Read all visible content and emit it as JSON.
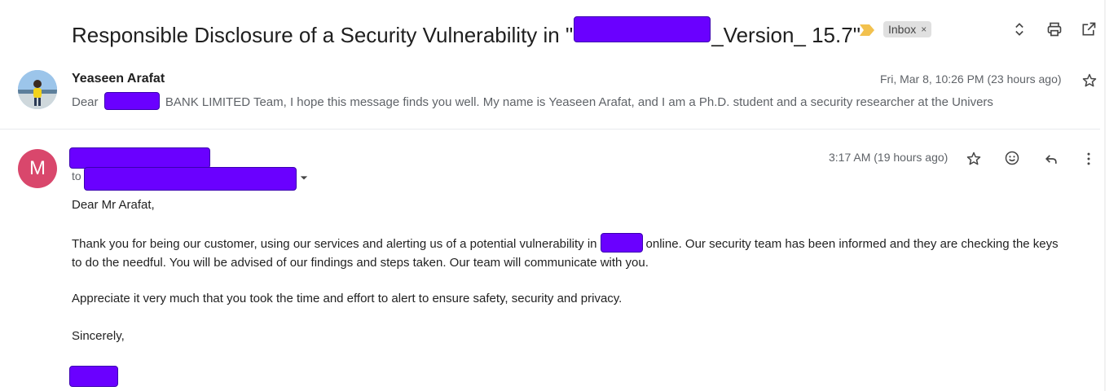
{
  "thread": {
    "subject_prefix": "Responsible Disclosure of a Security Vulnerability in \"",
    "subject_suffix": "_Version_ 15.7\"",
    "label": "Inbox",
    "label_remove": "×"
  },
  "message1": {
    "sender": "Yeaseen Arafat",
    "date": "Fri, Mar 8, 10:26 PM (23 hours ago)",
    "snippet_prefix": "Dear",
    "snippet_rest": "BANK LIMITED Team, I hope this message finds you well. My name is Yeaseen Arafat, and I am a Ph.D. student and a security researcher at the Univers"
  },
  "message2": {
    "avatar_letter": "M",
    "to_label": "to",
    "date": "3:17 AM (19 hours ago)",
    "greeting": "Dear Mr Arafat,",
    "para1_a": "Thank you for being our customer, using our services and alerting us of a potential vulnerability in",
    "para1_b": "online. Our security team has been informed and they are checking the keys",
    "para1_c": "to do the needful. You will be advised of our findings and steps taken. Our team will communicate with you.",
    "para2": "Appreciate it very much that you took the time and effort to alert to ensure safety, security and privacy.",
    "closing": "Sincerely,"
  },
  "colors": {
    "redaction": "#6a00ff",
    "avatar_m": "#d9476c",
    "important_marker": "#f2c14e",
    "label_bg": "#e0e0e0"
  },
  "icons": {
    "expand": "unfold-icon",
    "print": "printer-icon",
    "popout": "open-in-new-window-icon",
    "star": "star-icon",
    "emoji": "emoji-icon",
    "reply": "reply-icon",
    "more": "more-vertical-icon",
    "dropdown": "caret-down-icon"
  }
}
